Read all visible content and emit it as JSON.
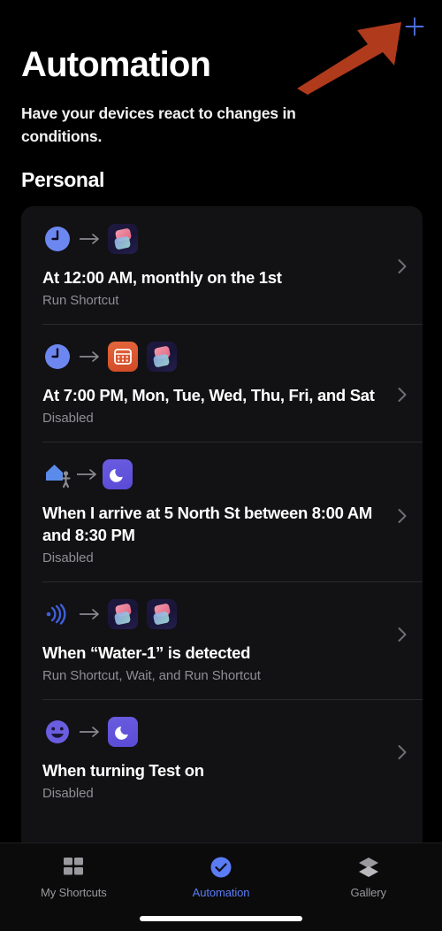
{
  "header": {
    "title": "Automation",
    "subtitle": "Have your devices react to changes in conditions.",
    "add_button_icon": "plus-icon",
    "add_button_color": "#4d6ee0"
  },
  "section": {
    "heading": "Personal"
  },
  "automations": [
    {
      "trigger_icon": "clock-icon",
      "action_icons": [
        "shortcuts-app-icon"
      ],
      "title": "At 12:00 AM, monthly on the 1st",
      "subtitle": "Run Shortcut",
      "chevron": "chevron-right-icon"
    },
    {
      "trigger_icon": "clock-icon",
      "action_icons": [
        "calendar-app-icon",
        "shortcuts-app-icon"
      ],
      "title": "At 7:00 PM, Mon, Tue, Wed, Thu, Fri, and Sat",
      "subtitle": "Disabled",
      "chevron": "chevron-right-icon"
    },
    {
      "trigger_icon": "home-arrive-icon",
      "action_icons": [
        "moon-focus-icon"
      ],
      "title": "When I arrive at 5 North St between 8:00 AM and 8:30 PM",
      "subtitle": "Disabled",
      "chevron": "chevron-right-icon"
    },
    {
      "trigger_icon": "nfc-waves-icon",
      "action_icons": [
        "shortcuts-app-icon",
        "shortcuts-app-icon"
      ],
      "title": "When “Water-1” is detected",
      "subtitle": "Run Shortcut, Wait, and Run Shortcut",
      "chevron": "chevron-right-icon"
    },
    {
      "trigger_icon": "smiley-face-icon",
      "action_icons": [
        "moon-focus-icon"
      ],
      "title": "When turning Test on",
      "subtitle": "Disabled",
      "chevron": "chevron-right-icon"
    }
  ],
  "tabbar": {
    "tabs": [
      {
        "label": "My Shortcuts",
        "icon": "grid-squares-icon",
        "active": false
      },
      {
        "label": "Automation",
        "icon": "clock-check-icon",
        "active": true
      },
      {
        "label": "Gallery",
        "icon": "layers-stack-icon",
        "active": false
      }
    ],
    "active_color": "#5a7cf5",
    "inactive_color": "#9a9a9e"
  },
  "annotation": {
    "type": "arrow",
    "color": "#b03a1c",
    "points_to": "add-automation-button"
  }
}
